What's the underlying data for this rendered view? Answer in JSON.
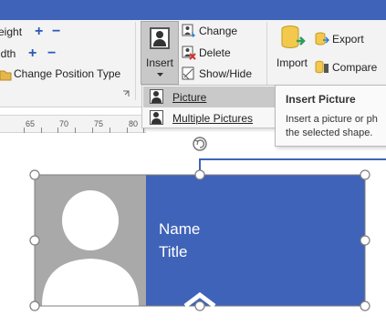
{
  "colors": {
    "accent": "#3f63b8",
    "card_blue": "#3f63b8",
    "photo_gray": "#a9a9a9",
    "menu_selected": "#c9c9c9"
  },
  "ribbon": {
    "height_label": "eight",
    "width_label": "idth",
    "change_position_type": "Change Position Type",
    "insert_button_label": "Insert",
    "change_label": "Change",
    "delete_label": "Delete",
    "show_hide_label": "Show/Hide",
    "import_label": "Import",
    "export_label": "Export",
    "compare_label": "Compare",
    "plus_glyph": "+",
    "minus_glyph": "−"
  },
  "ruler": {
    "ticks": [
      "65",
      "70",
      "75",
      "80"
    ]
  },
  "insert_menu": {
    "items": [
      {
        "label": "Picture",
        "selected": true
      },
      {
        "label": "Multiple Pictures",
        "selected": false
      }
    ]
  },
  "tooltip": {
    "title": "Insert Picture",
    "line1": "Insert a picture or ph",
    "line2": "the selected shape."
  },
  "card": {
    "name": "Name",
    "title": "Title"
  }
}
